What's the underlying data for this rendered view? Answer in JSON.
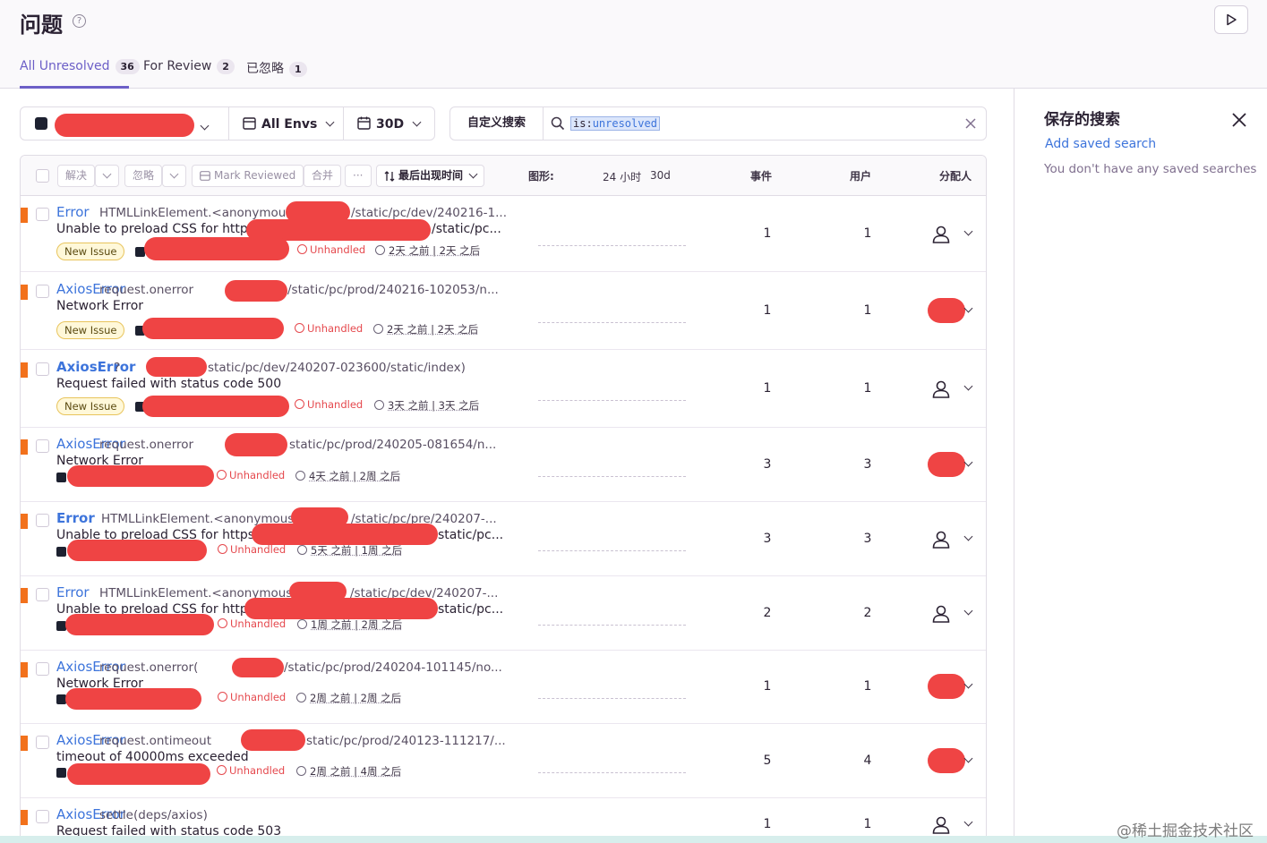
{
  "header": {
    "title": "问题",
    "tabs": [
      {
        "label": "All Unresolved",
        "count": "36"
      },
      {
        "label": "For Review",
        "count": "2"
      },
      {
        "label": "已忽略",
        "count": "1"
      }
    ]
  },
  "filters": {
    "envs": "All Envs",
    "period": "30D",
    "search_label": "自定义搜索",
    "query_key": "is:",
    "query_value": "unresolved"
  },
  "table_header": {
    "resolve": "解决",
    "ignore": "忽略",
    "mark_reviewed": "Mark Reviewed",
    "merge": "合并",
    "more": "···",
    "sort": "最后出现时间",
    "graph": "图形:",
    "graph_24h": "24 小时",
    "graph_30d": "30d",
    "events": "事件",
    "users": "用户",
    "assignee": "分配人"
  },
  "rows": [
    {
      "type": "Error",
      "culprit": "HTMLLinkElement.<anonymous>",
      "culprit_tail": "/static/pc/dev/240216-1...",
      "message": "Unable to preload CSS for https:/",
      "message_tail": "/static/pc...",
      "badge": "New Issue",
      "unhandled": "Unhandled",
      "age": "2天 之前 | 2天 之后",
      "events": "1",
      "users": "1"
    },
    {
      "type": "AxiosError",
      "culprit": "request.onerror",
      "culprit_tail": "/static/pc/prod/240216-102053/n...",
      "message": "Network Error",
      "message_tail": "",
      "badge": "New Issue",
      "unhandled": "Unhandled",
      "age": "2天 之前 | 2天 之后",
      "events": "1",
      "users": "1"
    },
    {
      "type": "AxiosError",
      "culprit": "?",
      "culprit_tail": "static/pc/dev/240207-023600/static/index)",
      "message": "Request failed with status code 500",
      "message_tail": "",
      "badge": "New Issue",
      "unhandled": "Unhandled",
      "age": "3天 之前 | 3天 之后",
      "events": "1",
      "users": "1"
    },
    {
      "type": "AxiosError",
      "culprit": "request.onerror",
      "culprit_tail": "static/pc/prod/240205-081654/n...",
      "message": "Network Error",
      "message_tail": "",
      "badge": "",
      "unhandled": "Unhandled",
      "age": "4天 之前 | 2周 之后",
      "events": "3",
      "users": "3"
    },
    {
      "type": "Error",
      "culprit": "HTMLLinkElement.<anonymous>",
      "culprit_tail": "/static/pc/pre/240207-...",
      "message": "Unable to preload CSS for https:/",
      "message_tail": "static/pc...",
      "badge": "",
      "unhandled": "Unhandled",
      "age": "5天 之前 | 1周 之后",
      "events": "3",
      "users": "3"
    },
    {
      "type": "Error",
      "culprit": "HTMLLinkElement.<anonymous>",
      "culprit_tail": "/static/pc/dev/240207-...",
      "message": "Unable to preload CSS for https:",
      "message_tail": "static/pc...",
      "badge": "",
      "unhandled": "Unhandled",
      "age": "1周 之前 | 2周 之后",
      "events": "2",
      "users": "2"
    },
    {
      "type": "AxiosError",
      "culprit": "request.onerror(",
      "culprit_tail": "/static/pc/prod/240204-101145/no...",
      "message": "Network Error",
      "message_tail": "",
      "badge": "",
      "unhandled": "Unhandled",
      "age": "2周 之前 | 2周 之后",
      "events": "1",
      "users": "1"
    },
    {
      "type": "AxiosError",
      "culprit": "request.ontimeout",
      "culprit_tail": "static/pc/prod/240123-111217/...",
      "message": "timeout of 40000ms exceeded",
      "message_tail": "",
      "badge": "",
      "unhandled": "Unhandled",
      "age": "2周 之前 | 4周 之后",
      "events": "5",
      "users": "4"
    },
    {
      "type": "AxiosError",
      "culprit": "settle(deps/axios)",
      "culprit_tail": "",
      "message": "Request failed with status code 503",
      "message_tail": "",
      "badge": "",
      "unhandled": "",
      "age": "",
      "events": "1",
      "users": "1"
    }
  ],
  "side_panel": {
    "title": "保存的搜索",
    "add_link": "Add saved search",
    "empty_text": "You don't have any saved searches"
  },
  "watermark": "@稀土掘金技术社区"
}
